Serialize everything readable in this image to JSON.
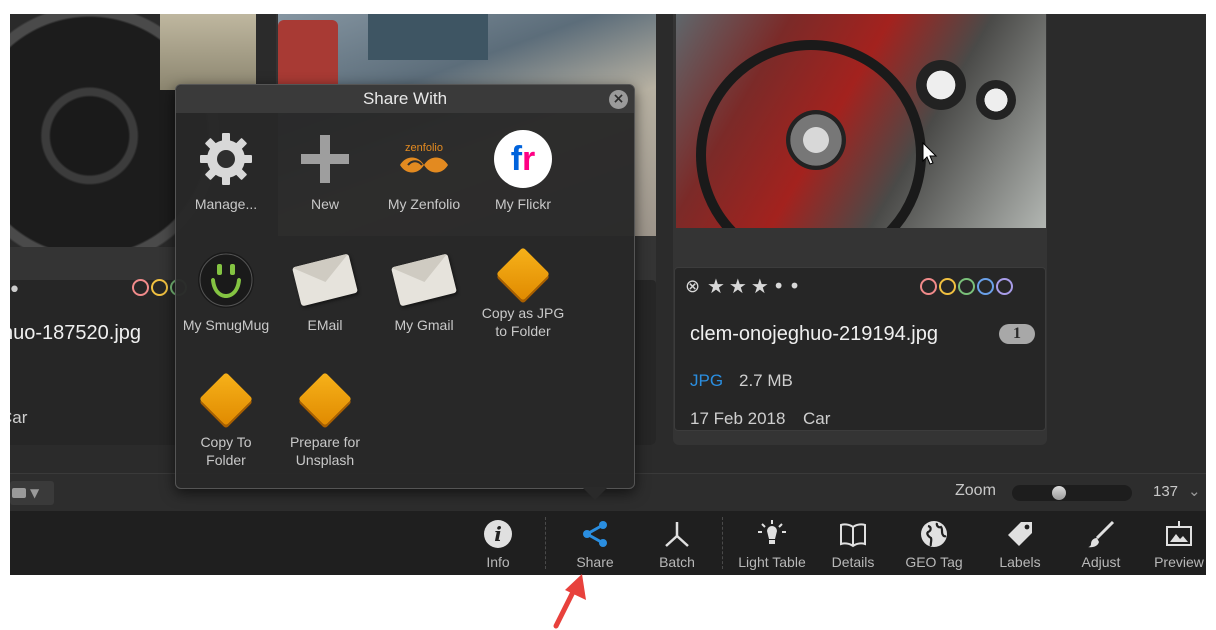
{
  "cards": {
    "left": {
      "filename": "huo-187520.jpg",
      "date_tag": "Car",
      "rating_dot": "•",
      "color_labels": [
        "#f08a8a",
        "#f0c040",
        "#7ac07a"
      ]
    },
    "right": {
      "reject_icon": "⊗",
      "rating": "★★★••",
      "color_labels": [
        "#f08a8a",
        "#f0c040",
        "#7ac07a",
        "#6aa0e8",
        "#a89ce8"
      ],
      "filename": "clem-onojeghuo-219194.jpg",
      "badge": "1",
      "type": "JPG",
      "size": "2.7 MB",
      "date": "17 Feb 2018",
      "tag": "Car"
    }
  },
  "zoom": {
    "label": "Zoom",
    "value": "137",
    "level_fraction": 0.38
  },
  "share_popup": {
    "title": "Share With",
    "items": [
      {
        "label": "Manage...",
        "icon": "gear-icon"
      },
      {
        "label": "New",
        "icon": "plus-icon"
      },
      {
        "label": "My Zenfolio",
        "icon": "zenfolio-logo"
      },
      {
        "label": "My Flickr",
        "icon": "flickr-logo"
      },
      {
        "label": "My SmugMug",
        "icon": "smugmug-logo"
      },
      {
        "label": "EMail",
        "icon": "envelope-icon"
      },
      {
        "label": "My Gmail",
        "icon": "envelope-icon"
      },
      {
        "label": "Copy as JPG\nto Folder",
        "icon": "folder-icon"
      },
      {
        "label": "Copy To\nFolder",
        "icon": "folder-icon"
      },
      {
        "label": "Prepare for\nUnsplash",
        "icon": "folder-icon"
      }
    ],
    "zenfolio_text": "zenfolio",
    "flickr_text": "fr"
  },
  "toolbar": {
    "items": [
      {
        "label": "Info",
        "icon": "info-icon"
      },
      {
        "label": "Share",
        "icon": "share-icon"
      },
      {
        "label": "Batch",
        "icon": "batch-icon"
      },
      {
        "label": "Light Table",
        "icon": "light-table-icon"
      },
      {
        "label": "Details",
        "icon": "book-icon"
      },
      {
        "label": "GEO Tag",
        "icon": "globe-icon"
      },
      {
        "label": "Labels",
        "icon": "tag-icon"
      },
      {
        "label": "Adjust",
        "icon": "brush-icon"
      },
      {
        "label": "Preview",
        "icon": "preview-icon"
      }
    ],
    "active": "Share",
    "accent": "#2a8ee0"
  },
  "annotation_arrow_color": "#e8413c"
}
